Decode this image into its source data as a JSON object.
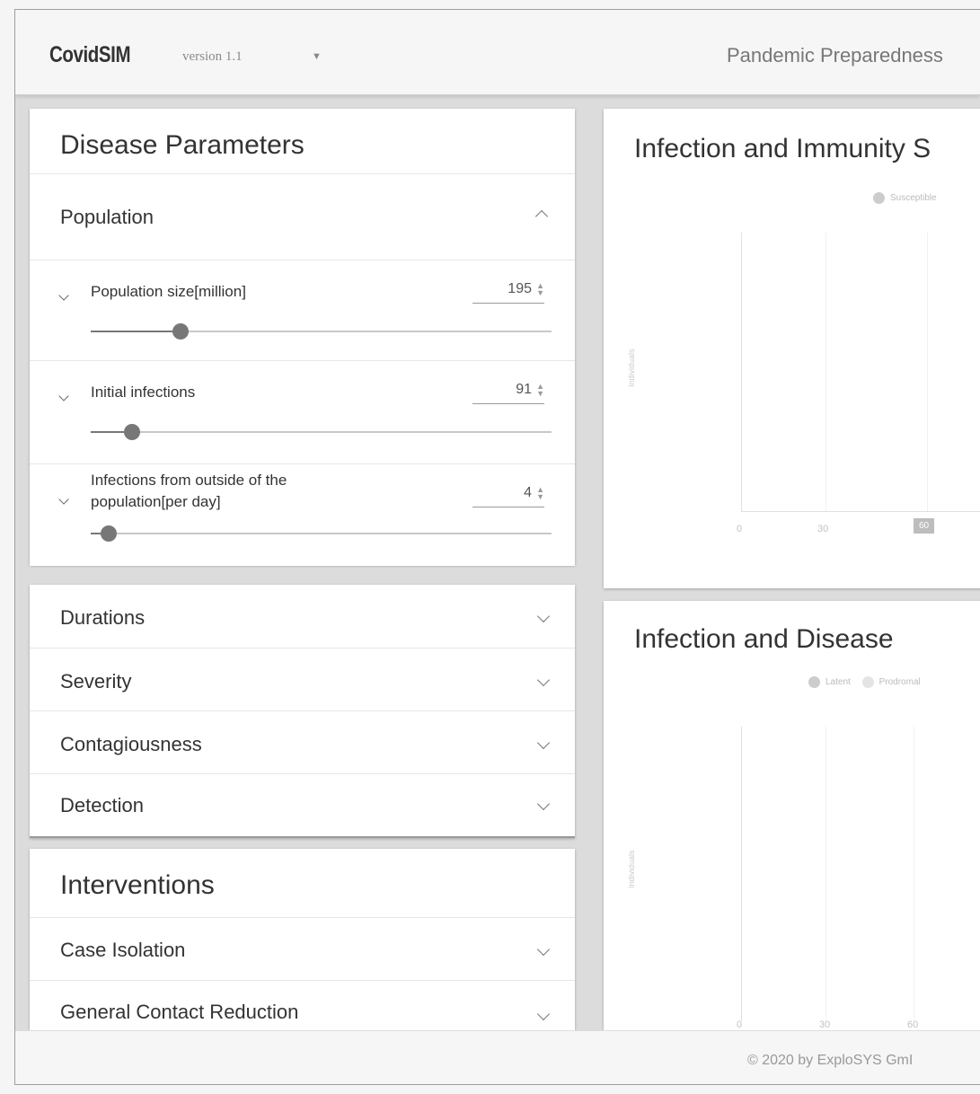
{
  "header": {
    "brand": "CovidSIM",
    "version": "version 1.1",
    "tagline": "Pandemic Preparedness"
  },
  "disease_parameters": {
    "title": "Disease Parameters",
    "population": {
      "label": "Population",
      "params": [
        {
          "label": "Population size[million]",
          "value": "195",
          "slider_fraction": 0.2
        },
        {
          "label": "Initial infections",
          "value": "91",
          "slider_fraction": 0.09
        },
        {
          "label": "Infections from outside of the population[per day]",
          "value": "4",
          "slider_fraction": 0.04
        }
      ]
    },
    "sections": [
      "Durations",
      "Severity",
      "Contagiousness",
      "Detection"
    ]
  },
  "interventions": {
    "title": "Interventions",
    "sections": [
      "Case Isolation",
      "General Contact Reduction"
    ]
  },
  "charts": [
    {
      "title": "Infection and Immunity S",
      "legend": [
        "Susceptible"
      ],
      "ylabel": "Individuals",
      "x_ticks": [
        "0",
        "30",
        "60"
      ],
      "tooltip": "60"
    },
    {
      "title": "Infection and Disease",
      "legend": [
        "Latent",
        "Prodromal"
      ],
      "ylabel": "Individuals",
      "x_ticks": [
        "0",
        "30",
        "60"
      ]
    }
  ],
  "footer": {
    "text": "© 2020 by ExploSYS GmI"
  }
}
